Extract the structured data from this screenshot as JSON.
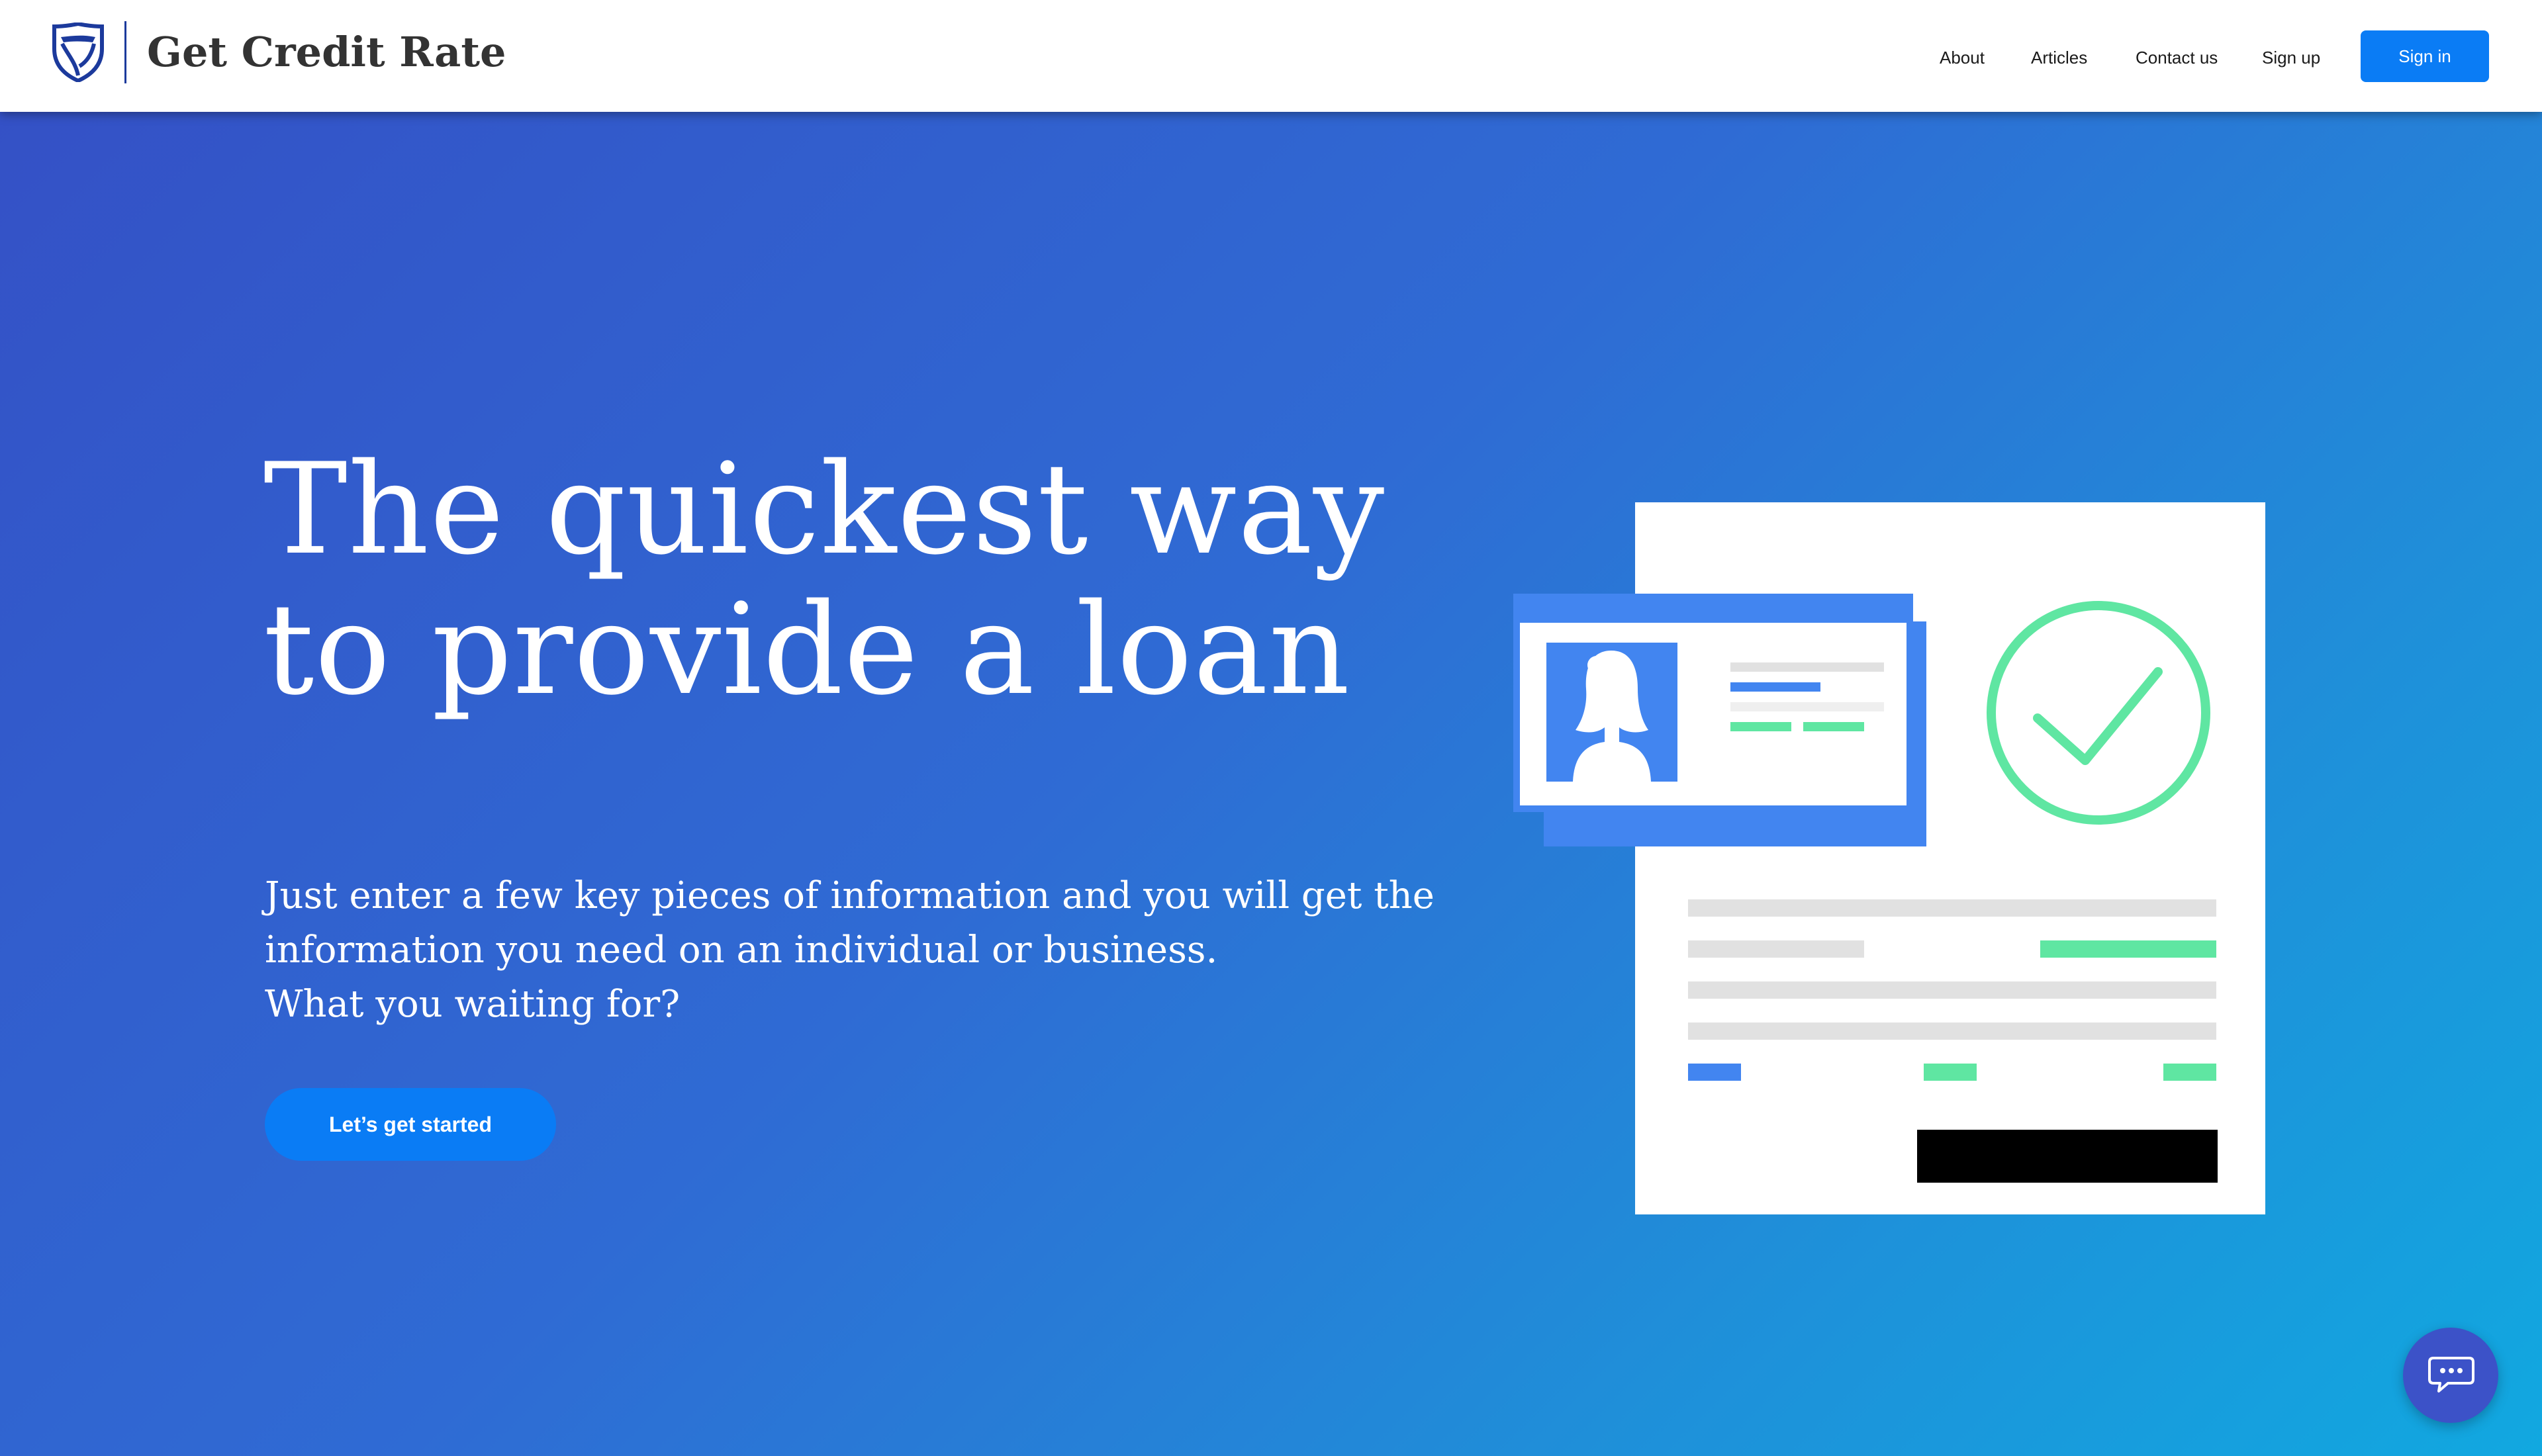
{
  "header": {
    "brand_name": "Get Credit Rate",
    "logo_icon": "shield-icon",
    "nav": [
      {
        "label": "About"
      },
      {
        "label": "Articles"
      },
      {
        "label": "Contact us"
      },
      {
        "label": "Sign up"
      }
    ],
    "signin_label": "Sign in"
  },
  "hero": {
    "title_lines": [
      "The quickest way",
      "to provide a loan"
    ],
    "subtitle_lines": [
      "Just enter a few key pieces of information and you will get the",
      "information you need on an individual or business.",
      "What you waiting for?"
    ],
    "cta_label": "Let’s get started"
  },
  "illustration": {
    "icons": [
      "id-card-icon",
      "person-avatar-icon",
      "checkmark-icon"
    ]
  },
  "chat": {
    "icon": "chat-bubble-icon"
  },
  "colors": {
    "primary_button": "#0a7cf5",
    "hero_gradient_start": "#3451c6",
    "hero_gradient_end": "#11a8e0",
    "brand_dark": "#1c3a9c",
    "card_blue": "#4285f0",
    "success_green": "#5fe6a2",
    "placeholder_gray": "#e1e1e1"
  }
}
